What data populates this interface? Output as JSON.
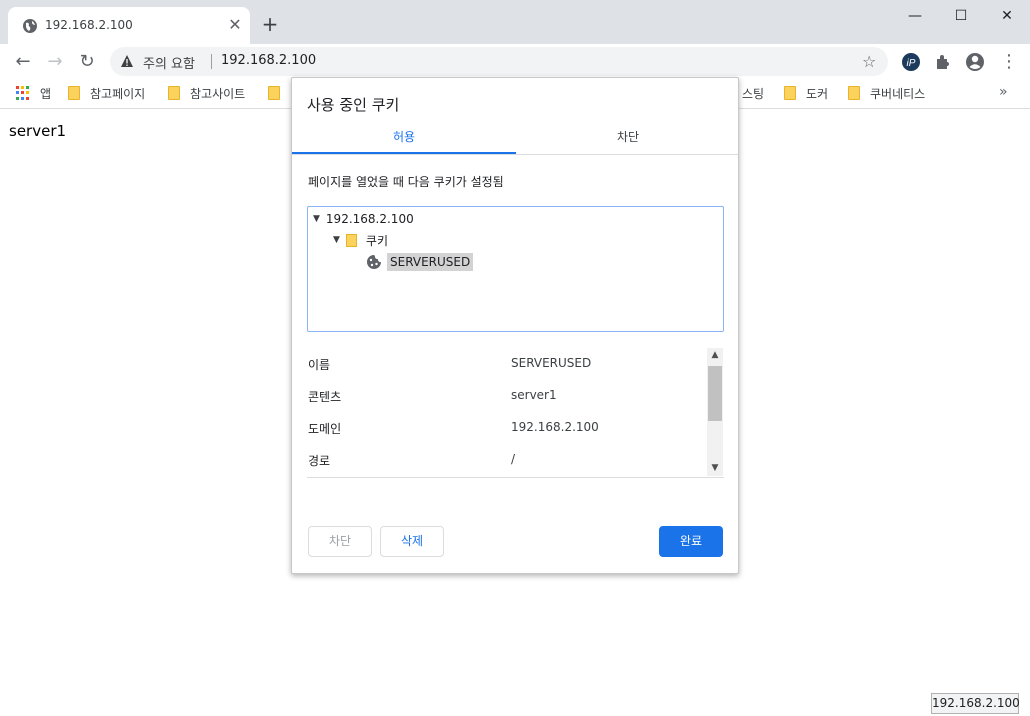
{
  "browser": {
    "tab_title": "192.168.2.100",
    "close_glyph": "✕",
    "newtab_glyph": "+",
    "window": {
      "minimize": "—",
      "maximize": "☐",
      "close": "✕"
    }
  },
  "toolbar": {
    "back_glyph": "←",
    "forward_glyph": "→",
    "reload_glyph": "↻",
    "security_warning": "주의 요함",
    "url": "192.168.2.100",
    "star_glyph": "☆",
    "ipfs_label": "iP"
  },
  "bookmarks": {
    "apps_label": "앱",
    "items": [
      "참고페이지",
      "참고사이트",
      "",
      "",
      "",
      "",
      "스팅",
      "도커",
      "쿠버네티스"
    ],
    "more_glyph": "»",
    "apps_colors": [
      "#ea4335",
      "#fbbc04",
      "#34a853",
      "#4285f4",
      "#ea4335",
      "#fbbc04",
      "#34a853",
      "#4285f4",
      "#ea4335"
    ]
  },
  "page": {
    "content_text": "server1"
  },
  "dialog": {
    "title": "사용 중인 쿠키",
    "tabs": [
      {
        "label": "허용",
        "active": true
      },
      {
        "label": "차단",
        "active": false
      }
    ],
    "description": "페이지를 열었을 때 다음 쿠키가 설정됨",
    "tree": {
      "host": "192.168.2.100",
      "folder": "쿠키",
      "cookie": "SERVERUSED",
      "expanded_glyph": "▼"
    },
    "details": [
      {
        "label": "이름",
        "value": "SERVERUSED"
      },
      {
        "label": "콘텐츠",
        "value": "server1"
      },
      {
        "label": "도메인",
        "value": "192.168.2.100"
      },
      {
        "label": "경로",
        "value": "/"
      }
    ],
    "scroll_up_glyph": "▲",
    "scroll_down_glyph": "▼",
    "buttons": {
      "block": "차단",
      "delete": "삭제",
      "done": "완료"
    }
  },
  "status_bar": {
    "link_preview": "192.168.2.100"
  },
  "colors": {
    "accent": "#1a73e8",
    "folder": "#fbd35c"
  }
}
